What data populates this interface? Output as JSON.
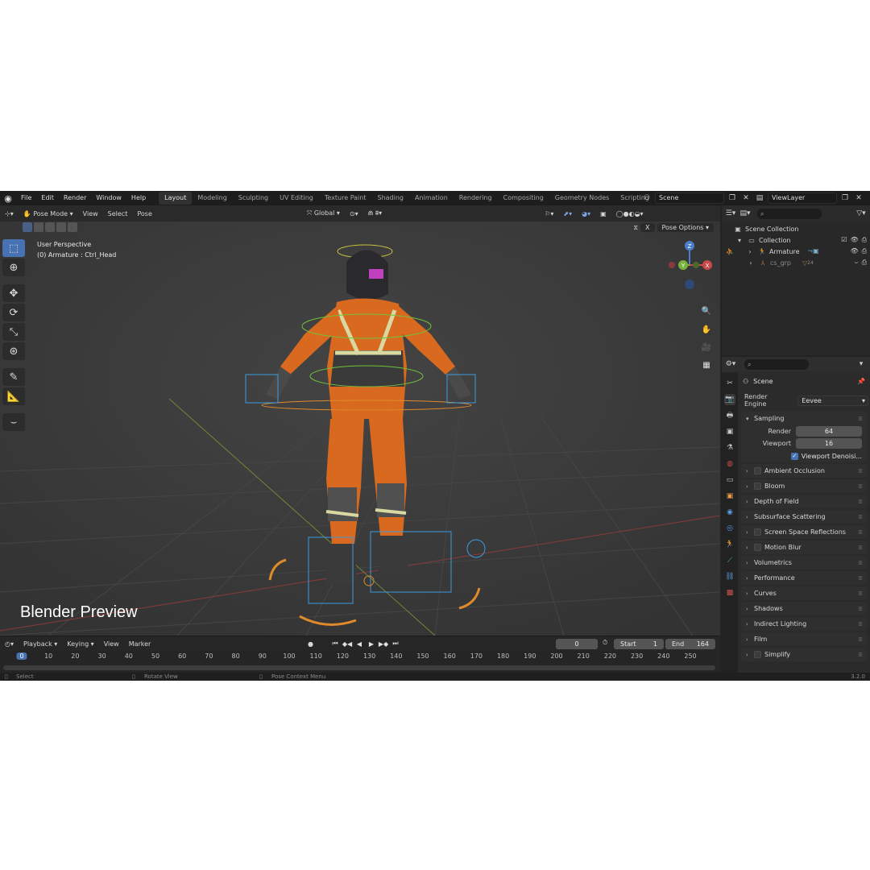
{
  "topbar": {
    "menus": [
      "File",
      "Edit",
      "Render",
      "Window",
      "Help"
    ],
    "workspaces": [
      "Layout",
      "Modeling",
      "Sculpting",
      "UV Editing",
      "Texture Paint",
      "Shading",
      "Animation",
      "Rendering",
      "Compositing",
      "Geometry Nodes",
      "Scripting"
    ],
    "active_workspace": "Layout",
    "scene": "Scene",
    "view_layer": "ViewLayer"
  },
  "viewport": {
    "mode": "Pose Mode",
    "menus": [
      "View",
      "Select",
      "Pose"
    ],
    "orientation": "Global",
    "pose_options": "Pose Options",
    "x_mirror": "X",
    "perspective_label": "User Perspective",
    "object_label": "(0) Armature : Ctrl_Head",
    "overlay_caption": "Blender Preview",
    "gizmo_axes": [
      "Z",
      "Y",
      "X"
    ]
  },
  "timeline": {
    "menus": [
      "Playback",
      "Keying",
      "View",
      "Marker"
    ],
    "current_frame": "0",
    "start_label": "Start",
    "start": "1",
    "end_label": "End",
    "end": "164",
    "ticks": [
      "0",
      "10",
      "20",
      "30",
      "40",
      "50",
      "60",
      "70",
      "80",
      "90",
      "100",
      "110",
      "120",
      "130",
      "140",
      "150",
      "160",
      "170",
      "180",
      "190",
      "200",
      "210",
      "220",
      "230",
      "240",
      "250"
    ]
  },
  "statusbar": {
    "select": "Select",
    "rotate": "Rotate View",
    "context": "Pose Context Menu",
    "version": "3.2.0"
  },
  "outliner": {
    "root": "Scene Collection",
    "collection": "Collection",
    "armature": "Armature",
    "cs_grp": "cs_grp",
    "cs_count": "24"
  },
  "properties": {
    "context": "Scene",
    "render_engine_label": "Render Engine",
    "render_engine": "Eevee",
    "sampling": {
      "title": "Sampling",
      "render_label": "Render",
      "render_value": "64",
      "viewport_label": "Viewport",
      "viewport_value": "16",
      "denoise_label": "Viewport Denoisi..."
    },
    "panels": [
      {
        "label": "Ambient Occlusion",
        "checkbox": true
      },
      {
        "label": "Bloom",
        "checkbox": true
      },
      {
        "label": "Depth of Field",
        "checkbox": false
      },
      {
        "label": "Subsurface Scattering",
        "checkbox": false
      },
      {
        "label": "Screen Space Reflections",
        "checkbox": true
      },
      {
        "label": "Motion Blur",
        "checkbox": true
      },
      {
        "label": "Volumetrics",
        "checkbox": false
      },
      {
        "label": "Performance",
        "checkbox": false
      },
      {
        "label": "Curves",
        "checkbox": false
      },
      {
        "label": "Shadows",
        "checkbox": false
      },
      {
        "label": "Indirect Lighting",
        "checkbox": false
      },
      {
        "label": "Film",
        "checkbox": false
      },
      {
        "label": "Simplify",
        "checkbox": true
      }
    ]
  },
  "colors": {
    "accent": "#4772b3",
    "suit_orange": "#d9691e",
    "bone_blue": "#3a9be0",
    "bone_green": "#6fc23a",
    "bone_orange": "#e08a2a"
  }
}
